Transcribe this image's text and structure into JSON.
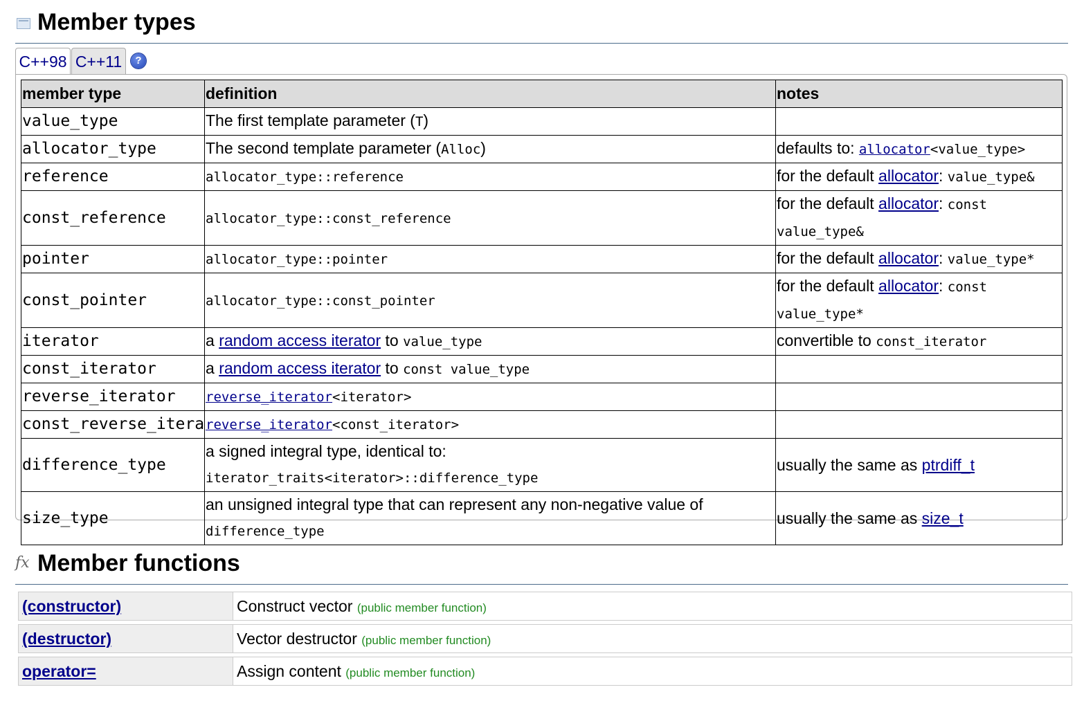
{
  "member_types": {
    "title": "Member types",
    "tabs": [
      "C++98",
      "C++11"
    ],
    "help": "?",
    "headers": [
      "member type",
      "definition",
      "notes"
    ],
    "rows": [
      {
        "name": "value_type",
        "def": [
          {
            "t": "The first template parameter ("
          },
          {
            "m": "T"
          },
          {
            "t": ")"
          }
        ],
        "notes": []
      },
      {
        "name": "allocator_type",
        "def": [
          {
            "t": "The second template parameter ("
          },
          {
            "m": "Alloc"
          },
          {
            "t": ")"
          }
        ],
        "notes": [
          {
            "t": "defaults to: "
          },
          {
            "ml": "allocator"
          },
          {
            "m": "<value_type>"
          }
        ]
      },
      {
        "name": "reference",
        "def": [
          {
            "m": "allocator_type::reference"
          }
        ],
        "notes": [
          {
            "t": "for the default "
          },
          {
            "l": "allocator"
          },
          {
            "t": ": "
          },
          {
            "m": "value_type&"
          }
        ]
      },
      {
        "name": "const_reference",
        "def": [
          {
            "m": "allocator_type::const_reference"
          }
        ],
        "notes": [
          {
            "t": "for the default "
          },
          {
            "l": "allocator"
          },
          {
            "t": ": "
          },
          {
            "m": "const value_type&"
          }
        ]
      },
      {
        "name": "pointer",
        "def": [
          {
            "m": "allocator_type::pointer"
          }
        ],
        "notes": [
          {
            "t": "for the default "
          },
          {
            "l": "allocator"
          },
          {
            "t": ": "
          },
          {
            "m": "value_type*"
          }
        ]
      },
      {
        "name": "const_pointer",
        "def": [
          {
            "m": "allocator_type::const_pointer"
          }
        ],
        "notes": [
          {
            "t": "for the default "
          },
          {
            "l": "allocator"
          },
          {
            "t": ": "
          },
          {
            "m": "const value_type*"
          }
        ]
      },
      {
        "name": "iterator",
        "def": [
          {
            "t": "a "
          },
          {
            "l": "random access iterator"
          },
          {
            "t": " to "
          },
          {
            "m": "value_type"
          }
        ],
        "notes": [
          {
            "t": "convertible to "
          },
          {
            "m": "const_iterator"
          }
        ]
      },
      {
        "name": "const_iterator",
        "def": [
          {
            "t": "a "
          },
          {
            "l": "random access iterator"
          },
          {
            "t": " to "
          },
          {
            "m": "const value_type"
          }
        ],
        "notes": []
      },
      {
        "name": "reverse_iterator",
        "def": [
          {
            "ml": "reverse_iterator"
          },
          {
            "m": "<iterator>"
          }
        ],
        "notes": []
      },
      {
        "name": "const_reverse_iterator",
        "def": [
          {
            "ml": "reverse_iterator"
          },
          {
            "m": "<const_iterator>"
          }
        ],
        "notes": []
      },
      {
        "name": "difference_type",
        "def": [
          {
            "t": "a signed integral type, identical to: "
          },
          {
            "m": "iterator_traits<iterator>::difference_type"
          }
        ],
        "notes": [
          {
            "t": "usually the same as "
          },
          {
            "l": "ptrdiff_t"
          }
        ]
      },
      {
        "name": "size_type",
        "def": [
          {
            "t": "an unsigned integral type that can represent any non-negative value of "
          },
          {
            "m": "difference_type"
          }
        ],
        "notes": [
          {
            "t": "usually the same as "
          },
          {
            "l": "size_t"
          }
        ]
      }
    ]
  },
  "member_functions": {
    "title": "Member functions",
    "icon": "fx",
    "rows": [
      {
        "name": "(constructor)",
        "desc": "Construct vector",
        "kind": "(public member function)"
      },
      {
        "name": "(destructor)",
        "desc": "Vector destructor",
        "kind": "(public member function)"
      },
      {
        "name": "operator=",
        "desc": "Assign content",
        "kind": "(public member function)"
      }
    ]
  }
}
